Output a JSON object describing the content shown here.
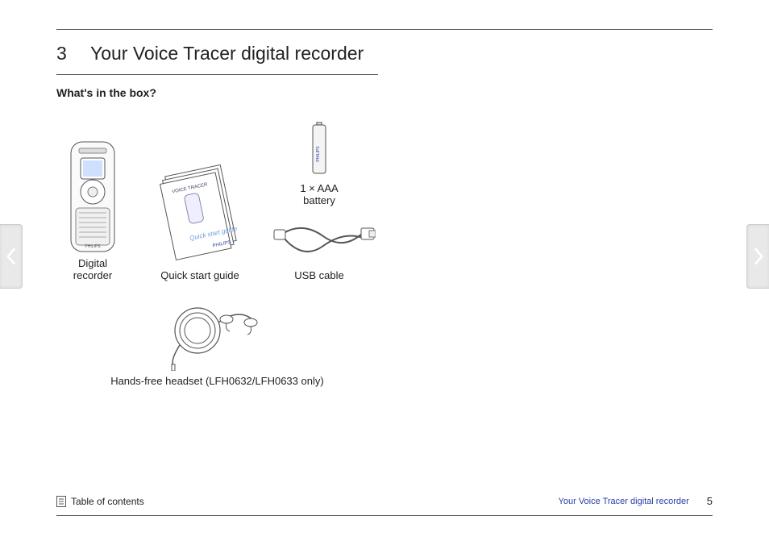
{
  "chapter": {
    "number": "3",
    "title": "Your Voice Tracer digital recorder"
  },
  "section": {
    "subhead": "What's in the box?"
  },
  "items": {
    "recorder": {
      "label": "Digital\nrecorder"
    },
    "guide": {
      "label": "Quick start guide"
    },
    "battery": {
      "label": "1 × AAA\nbattery"
    },
    "usb": {
      "label": "USB cable"
    },
    "headset": {
      "label": "Hands-free headset (LFH0632/LFH0633 only)"
    }
  },
  "footer": {
    "toc": "Table of contents",
    "chapter_ref": "Your Voice Tracer digital recorder",
    "page": "5"
  }
}
